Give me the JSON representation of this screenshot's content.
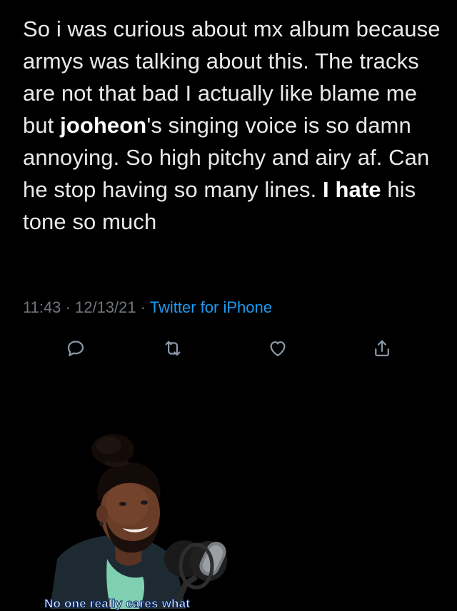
{
  "tweet": {
    "text_segments": [
      {
        "text": "So i was curious about mx album because armys was talking about this. The tracks are not that bad I actually like blame me but ",
        "bold": false
      },
      {
        "text": "jooheon",
        "bold": true
      },
      {
        "text": "'s singing voice is so damn annoying. So high pitchy and airy af. Can he stop having so many lines. ",
        "bold": false
      },
      {
        "text": "I hate",
        "bold": true
      },
      {
        "text": " his tone so much",
        "bold": false
      }
    ],
    "time": "11:43",
    "separator": " · ",
    "date": "12/13/21",
    "source": "Twitter for iPhone"
  },
  "actions": [
    {
      "name": "reply",
      "icon": "reply-icon"
    },
    {
      "name": "retweet",
      "icon": "retweet-icon"
    },
    {
      "name": "like",
      "icon": "heart-icon"
    },
    {
      "name": "share",
      "icon": "share-icon"
    }
  ],
  "video_overlay": {
    "caption": "No one really cares what"
  },
  "colors": {
    "background": "#000000",
    "text": "#e7e9ea",
    "muted": "#71767b",
    "link": "#1d9bf0"
  }
}
